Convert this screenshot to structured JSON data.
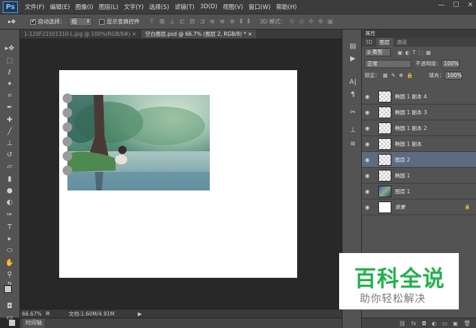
{
  "app": {
    "logo": "Ps"
  },
  "menu": [
    "文件(F)",
    "编辑(E)",
    "图像(I)",
    "图层(L)",
    "文字(Y)",
    "选择(S)",
    "滤镜(T)",
    "3D(D)",
    "视图(V)",
    "窗口(W)",
    "帮助(H)"
  ],
  "window_controls": [
    "—",
    "☐",
    "✕"
  ],
  "options": {
    "auto_select_label": "自动选择：",
    "auto_select_value": "组",
    "show_transform_label": "显示变换控件",
    "mode_3d_label": "3D 模式："
  },
  "tabs": [
    {
      "label": "1-120F21501310-L.jpg @ 100%(RGB/8#)",
      "close": "×"
    },
    {
      "label": "空白图层.psd @ 66.7% (图层 2, RGB/8) *",
      "close": "×"
    }
  ],
  "status": {
    "zoom": "66.67%",
    "doc_info": "文档:1.60M/4.91M"
  },
  "timeline_label": "时间轴",
  "panel": {
    "title": "属性",
    "tabs": [
      "3D",
      "图层",
      "通道"
    ],
    "filter_label": "ρ 类型",
    "blend_mode": "正常",
    "opacity_label": "不透明度：",
    "opacity_value": "100%",
    "lock_label": "锁定：",
    "fill_label": "填充：",
    "fill_value": "100%"
  },
  "layers": [
    {
      "name": "椭圆 1 副本 4",
      "thumb": "transparent",
      "selected": false
    },
    {
      "name": "椭圆 1 副本 3",
      "thumb": "transparent",
      "selected": false
    },
    {
      "name": "椭圆 1 副本 2",
      "thumb": "transparent",
      "selected": false
    },
    {
      "name": "椭圆 1 副本",
      "thumb": "transparent",
      "selected": false
    },
    {
      "name": "图层 2",
      "thumb": "transparent",
      "selected": true
    },
    {
      "name": "椭圆 1",
      "thumb": "transparent",
      "selected": false
    },
    {
      "name": "图层 1",
      "thumb": "photo",
      "selected": false
    },
    {
      "name": "背景",
      "thumb": "white",
      "selected": false,
      "locked": true
    }
  ],
  "watermark": {
    "title": "百科全说",
    "subtitle": "助你轻松解决"
  },
  "colors": {
    "accent": "#22b24c",
    "selected_layer": "#5d6b80"
  }
}
